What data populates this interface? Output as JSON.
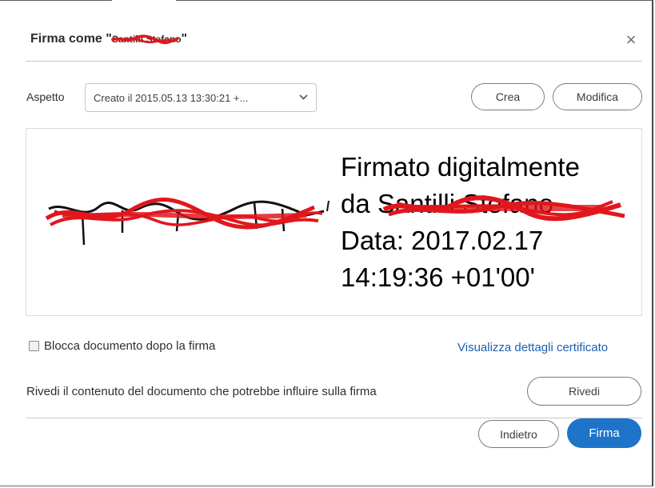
{
  "dialog": {
    "title_prefix": "Firma come \"",
    "title_name": "Santilli Stefano",
    "title_suffix": "\"",
    "close_symbol": "×"
  },
  "appearance": {
    "label": "Aspetto",
    "selected": "Creato il 2015.05.13 13:30:21 +...",
    "create_label": "Crea",
    "modify_label": "Modifica"
  },
  "signature_preview": {
    "lines": [
      "Firmato digitalmente",
      "da Santilli Stefano",
      "Data: 2017.02.17",
      "14:19:36 +01'00'"
    ]
  },
  "options": {
    "lock_document_label": "Blocca documento dopo la firma",
    "lock_document_checked": false,
    "certificate_link": "Visualizza dettagli certificato"
  },
  "review": {
    "text": "Rivedi il contenuto del documento che potrebbe influire sulla firma",
    "button_label": "Rivedi"
  },
  "footer": {
    "back_label": "Indietro",
    "sign_label": "Firma"
  },
  "colors": {
    "primary": "#1e74c9",
    "link": "#1b5fb0",
    "redaction": "#e0171d"
  }
}
